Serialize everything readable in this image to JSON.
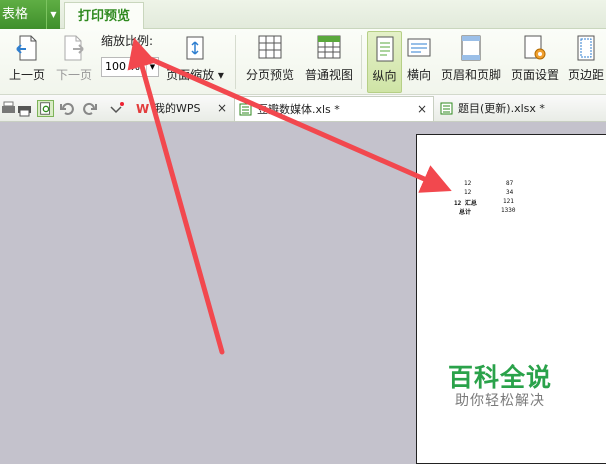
{
  "app_tab": {
    "label": "表格"
  },
  "ribbon_tab": {
    "label": "打印预览"
  },
  "zoom": {
    "label": "缩放比例:",
    "value": "100 %"
  },
  "buttons": {
    "prev_page": "上一页",
    "next_page": "下一页",
    "page_zoom": "页面缩放",
    "page_break_preview": "分页预览",
    "normal_view": "普通视图",
    "portrait": "纵向",
    "landscape": "横向",
    "header_footer": "页眉和页脚",
    "page_setup": "页面设置",
    "margins": "页边距"
  },
  "doc_tabs": [
    {
      "label": "我的WPS",
      "close": "×"
    },
    {
      "label": "豆瓣数媒体.xls *",
      "close": "×"
    },
    {
      "label": "题目(更新).xlsx *",
      "close": ""
    }
  ],
  "preview_rows": [
    {
      "a": "12",
      "b": "87"
    },
    {
      "a": "12",
      "b": "34"
    },
    {
      "a": "12 汇总",
      "b": "121"
    },
    {
      "a": "总计",
      "b": "1330"
    }
  ],
  "watermark": {
    "title": "百科全说",
    "subtitle": "助你轻松解决"
  },
  "colors": {
    "brand_green": "#3f8f2b",
    "arrow_red": "#f2484e",
    "watermark_green": "#2aa24a"
  }
}
